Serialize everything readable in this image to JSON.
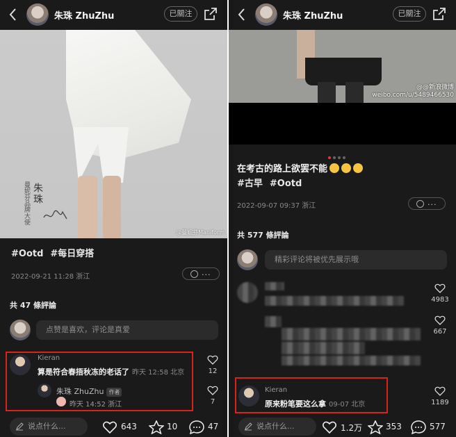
{
  "left": {
    "header": {
      "username": "朱珠 ZhuZhu",
      "follow_label": "已關注"
    },
    "photo": {
      "vertical_caption": "曼妮芬品牌大使",
      "vertical_name": "朱珠",
      "watermark": "@曼妮芬Maniform"
    },
    "tags": [
      "#Ootd",
      "#每日穿搭"
    ],
    "meta": "2022-09-21 11:28 浙江",
    "emoji_button_dots": "...",
    "comment_count": "共 47 條評論",
    "input_placeholder": "点赞是喜欢，评论是真爱",
    "comment": {
      "name": "Kieran",
      "text": "算是符合春捂秋冻的老话了",
      "time": "昨天 12:58 北京",
      "likes": "12"
    },
    "reply": {
      "name": "朱珠 ZhuZhu",
      "badge": "作者",
      "time": "昨天 14:52 浙江",
      "likes": "7"
    },
    "bottom": {
      "say": "说点什么...",
      "likes": "643",
      "stars": "10",
      "comments": "47"
    }
  },
  "right": {
    "header": {
      "username": "朱珠 ZhuZhu",
      "follow_label": "已關注"
    },
    "photo": {
      "watermark_line1": "@@新浪微博",
      "watermark_line2": "weibo.com/u/5489466530"
    },
    "caption": "在考古的路上欲罢不能",
    "tags": [
      "#古早",
      "#Ootd"
    ],
    "meta": "2022-09-07 09:37 浙江",
    "emoji_button_dots": "...",
    "comment_count": "共 577 條評論",
    "input_placeholder": "精彩评论将被优先展示哦",
    "blurred_likes": [
      "4983",
      "667"
    ],
    "comment": {
      "name": "Kieran",
      "text": "原来粉笔要这么拿",
      "time": "09-07 北京",
      "likes": "1189"
    },
    "bottom": {
      "say": "说点什么...",
      "likes": "1.2万",
      "stars": "353",
      "comments": "577"
    }
  },
  "colors": {
    "bg": "#1a1a1a",
    "highlight": "#d9231d",
    "text": "#e6e6e6"
  }
}
